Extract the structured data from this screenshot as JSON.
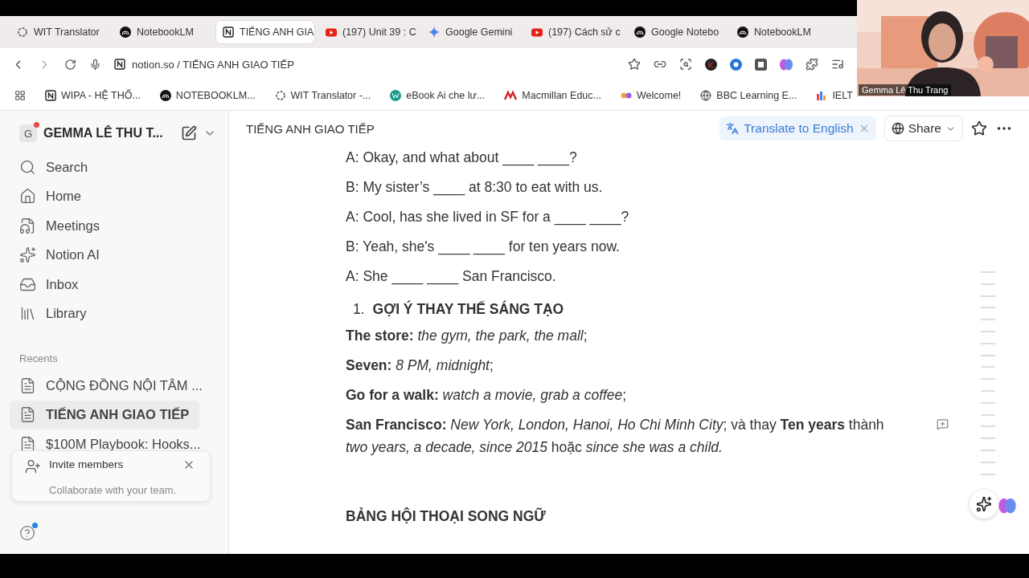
{
  "tabs": [
    {
      "label": "WIT Translator",
      "kind": "wit",
      "selected": false
    },
    {
      "label": "NotebookLM",
      "kind": "notebook",
      "selected": false
    },
    {
      "label": "TIẾNG ANH GIA",
      "kind": "notion",
      "selected": true
    },
    {
      "label": "(197) Unit 39 : C",
      "kind": "youtube",
      "selected": false
    },
    {
      "label": "Google Gemini",
      "kind": "gemini",
      "selected": false
    },
    {
      "label": "(197) Cách sử c",
      "kind": "youtube",
      "selected": false
    },
    {
      "label": "Google Notebo",
      "kind": "notebook",
      "selected": false
    },
    {
      "label": "NotebookLM",
      "kind": "notebook",
      "selected": false
    }
  ],
  "address_bar": {
    "url": "notion.so / TIẾNG ANH GIAO TIẾP"
  },
  "bookmarks": [
    {
      "label": "WIPA - HỆ THỐ...",
      "kind": "notion"
    },
    {
      "label": "NOTEBOOKLM...",
      "kind": "notebook"
    },
    {
      "label": "WIT Translator -...",
      "kind": "wit"
    },
    {
      "label": "eBook Ai che lư...",
      "kind": "ebook"
    },
    {
      "label": "Macmillan Educ...",
      "kind": "macmillan"
    },
    {
      "label": "Welcome!",
      "kind": "welcome"
    },
    {
      "label": "BBC Learning E...",
      "kind": "globe"
    },
    {
      "label": "IELT",
      "kind": "ielts"
    }
  ],
  "webcam": {
    "kind": "picture",
    "name": "Gemma Lê Thu Trang"
  },
  "sidebar": {
    "workspace": {
      "initial": "G",
      "name": "GEMMA LÊ THU T...",
      "notification": true
    },
    "items": [
      {
        "label": "Search",
        "kind": "search"
      },
      {
        "label": "Home",
        "kind": "home"
      },
      {
        "label": "Meetings",
        "kind": "meetings"
      },
      {
        "label": "Notion AI",
        "kind": "ai"
      },
      {
        "label": "Inbox",
        "kind": "inbox"
      },
      {
        "label": "Library",
        "kind": "library"
      }
    ],
    "recents_label": "Recents",
    "recents": [
      {
        "label": "CỘNG ĐỒNG NỘI TÂM ...",
        "selected": false
      },
      {
        "label": "TIẾNG ANH GIAO TIẾP",
        "selected": true
      },
      {
        "label": "$100M Playbook: Hooks...",
        "selected": false
      }
    ],
    "invite": {
      "title": "Invite members",
      "subtitle": "Collaborate with your team."
    },
    "help_notification": true
  },
  "page": {
    "breadcrumb": "TIẾNG ANH GIAO TIẾP",
    "translate": "Translate to English",
    "share": "Share",
    "blocks": [
      {
        "kind": "text",
        "text": "A: Okay, and what about ____ ____?"
      },
      {
        "kind": "text",
        "text": "B: My sister’s ____ at 8:30 to eat with us."
      },
      {
        "kind": "text",
        "text": "A: Cool, has she lived in SF for a ____ ____?"
      },
      {
        "kind": "text",
        "text": "B: Yeah, she's ____ ____ for ten years now."
      },
      {
        "kind": "text",
        "text": "A: She ____ ____ San Francisco."
      },
      {
        "kind": "numbered",
        "number": "1.",
        "text": "GỢI Ý THAY THẾ SÁNG TẠO"
      },
      {
        "kind": "text",
        "text": "**The store:** *the gym, the park, the mall*;"
      },
      {
        "kind": "text",
        "text": "**Seven:**  *8 PM, midnight*;"
      },
      {
        "kind": "text",
        "text": "**Go for a walk:** *watch a movie, grab a coffee*;"
      },
      {
        "kind": "text",
        "text": "**San Francisco:** *New York, London, Hanoi, Ho Chi Minh City*; và thay **Ten years** thành *two years, a decade, since 2015* hoặc *since she was a child.*",
        "comment": true
      },
      {
        "kind": "spacer"
      },
      {
        "kind": "heading",
        "text": "BẢNG HỘI THOẠI SONG NGỮ"
      }
    ]
  }
}
